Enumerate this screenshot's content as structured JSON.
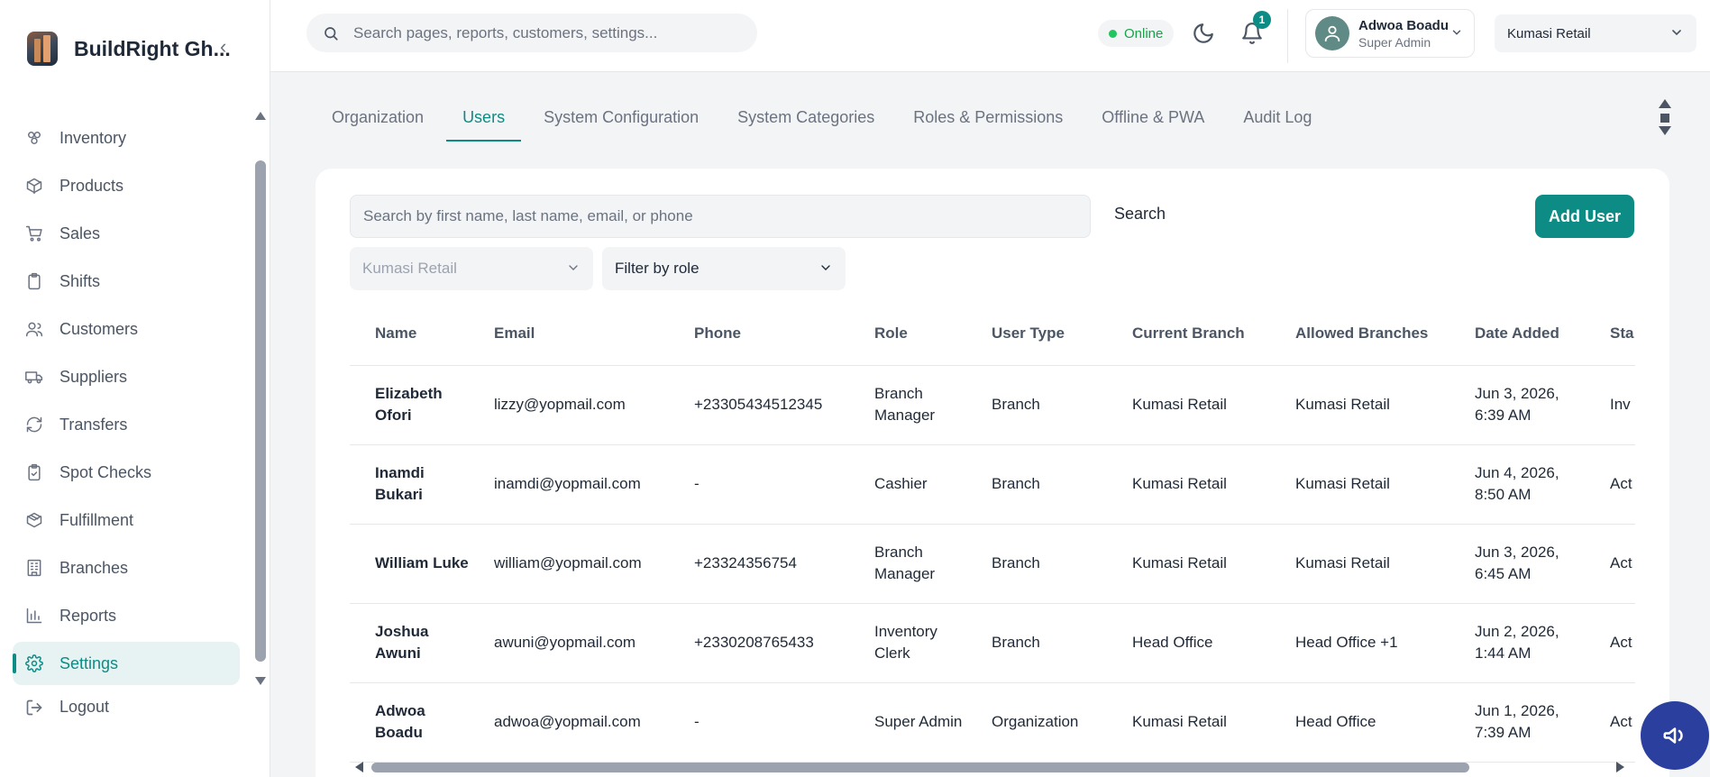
{
  "brand": {
    "name": "BuildRight Gh..."
  },
  "sidebar": {
    "items": [
      {
        "label": "Inventory",
        "icon": "inventory-icon"
      },
      {
        "label": "Products",
        "icon": "products-icon"
      },
      {
        "label": "Sales",
        "icon": "cart-icon"
      },
      {
        "label": "Shifts",
        "icon": "clipboard-icon"
      },
      {
        "label": "Customers",
        "icon": "users-icon"
      },
      {
        "label": "Suppliers",
        "icon": "truck-icon"
      },
      {
        "label": "Transfers",
        "icon": "refresh-icon"
      },
      {
        "label": "Spot Checks",
        "icon": "clipboard-check-icon"
      },
      {
        "label": "Fulfillment",
        "icon": "package-icon"
      },
      {
        "label": "Branches",
        "icon": "building-icon"
      },
      {
        "label": "Reports",
        "icon": "bar-chart-icon"
      },
      {
        "label": "Settings",
        "icon": "gear-icon",
        "active": true
      }
    ],
    "logout": "Logout"
  },
  "header": {
    "search_placeholder": "Search pages, reports, customers, settings...",
    "status": "Online",
    "notification_count": "1",
    "user": {
      "name": "Adwoa Boadu",
      "role": "Super Admin"
    },
    "branch": "Kumasi Retail"
  },
  "tabs": [
    {
      "label": "Organization"
    },
    {
      "label": "Users",
      "active": true
    },
    {
      "label": "System Configuration"
    },
    {
      "label": "System Categories"
    },
    {
      "label": "Roles & Permissions"
    },
    {
      "label": "Offline & PWA"
    },
    {
      "label": "Audit Log"
    }
  ],
  "users_panel": {
    "search_placeholder": "Search by first name, last name, email, or phone",
    "search_button": "Search",
    "add_button": "Add User",
    "branch_filter": "Kumasi Retail",
    "role_filter": "Filter by role",
    "columns": [
      "Name",
      "Email",
      "Phone",
      "Role",
      "User Type",
      "Current Branch",
      "Allowed Branches",
      "Date Added",
      "Sta"
    ],
    "rows": [
      {
        "name": "Elizabeth Ofori",
        "email": "lizzy@yopmail.com",
        "phone": "+23305434512345",
        "role": "Branch Manager",
        "user_type": "Branch",
        "current_branch": "Kumasi Retail",
        "allowed_branches": "Kumasi Retail",
        "date_added": "Jun 3, 2026, 6:39 AM",
        "status": "Inv Exp"
      },
      {
        "name": "Inamdi Bukari",
        "email": "inamdi@yopmail.com",
        "phone": "-",
        "role": "Cashier",
        "user_type": "Branch",
        "current_branch": "Kumasi Retail",
        "allowed_branches": "Kumasi Retail",
        "date_added": "Jun 4, 2026, 8:50 AM",
        "status": "Act"
      },
      {
        "name": "William Luke",
        "email": "william@yopmail.com",
        "phone": "+23324356754",
        "role": "Branch Manager",
        "user_type": "Branch",
        "current_branch": "Kumasi Retail",
        "allowed_branches": "Kumasi Retail",
        "date_added": "Jun 3, 2026, 6:45 AM",
        "status": "Act"
      },
      {
        "name": "Joshua Awuni",
        "email": "awuni@yopmail.com",
        "phone": "+2330208765433",
        "role": "Inventory Clerk",
        "user_type": "Branch",
        "current_branch": "Head Office",
        "allowed_branches": "Head Office +1",
        "date_added": "Jun 2, 2026, 1:44 AM",
        "status": "Act"
      },
      {
        "name": "Adwoa Boadu",
        "email": "adwoa@yopmail.com",
        "phone": "-",
        "role": "Super Admin",
        "user_type": "Organization",
        "current_branch": "Kumasi Retail",
        "allowed_branches": "Head Office",
        "date_added": "Jun 1, 2026, 7:39 AM",
        "status": "Act"
      }
    ]
  },
  "colors": {
    "accent": "#0d8b85",
    "fab": "#2a3f9e"
  },
  "fab_icon": "megaphone-icon"
}
